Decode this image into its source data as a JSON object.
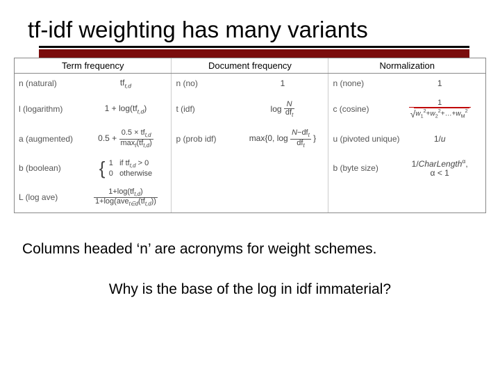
{
  "title": "tf-idf weighting has many variants",
  "table": {
    "headers": {
      "tf": "Term frequency",
      "df": "Document frequency",
      "norm": "Normalization"
    },
    "tf": {
      "n_label": "n (natural)",
      "n_formula": "tf_{t,d}",
      "l_label": "l (logarithm)",
      "l_formula": "1 + log(tf_{t,d})",
      "a_label": "a (augmented)",
      "a_prefix": "0.5 +",
      "a_num": "0.5 × tf_{t,d}",
      "a_den": "max_t (tf_{t,d})",
      "b_label": "b (boolean)",
      "b_line1": "1   if tf_{t,d} > 0",
      "b_line2": "0   otherwise",
      "L_label": "L (log ave)",
      "L_num": "1 + log(tf_{t,d})",
      "L_den": "1 + log(ave_{t∈d}(tf_{t,d}))"
    },
    "df": {
      "n_label": "n (no)",
      "n_formula": "1",
      "t_label": "t (idf)",
      "t_prefix": "log",
      "t_num": "N",
      "t_den": "df_t",
      "p_label": "p (prob idf)",
      "p_prefix": "max{0, log",
      "p_num": "N − df_t",
      "p_den": "df_t",
      "p_suffix": "}"
    },
    "norm": {
      "n_label": "n (none)",
      "n_formula": "1",
      "c_label": "c (cosine)",
      "c_num": "1",
      "c_den": "w₁² + w₂² + … + w_M²",
      "u_label": "u (pivoted unique)",
      "u_formula": "1/u",
      "b_label": "b (byte size)",
      "b_line1": "1/CharLength^α,",
      "b_line2": "α < 1"
    }
  },
  "caption": "Columns headed ‘n’ are acronyms for weight schemes.",
  "question": "Why is the base of the log in idf immaterial?"
}
